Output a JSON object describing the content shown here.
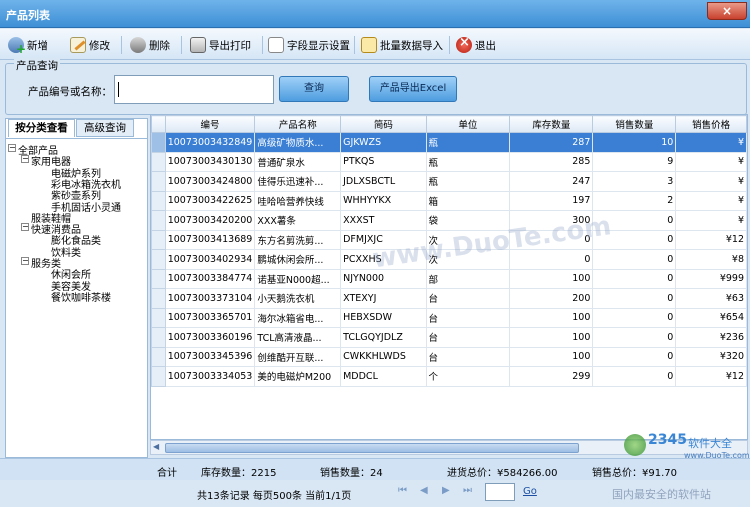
{
  "window": {
    "title": "产品列表",
    "close_glyph": "×"
  },
  "toolbar": {
    "add": "新增",
    "edit": "修改",
    "delete": "删除",
    "export_print": "导出打印",
    "field_settings": "字段显示设置",
    "batch_import": "批量数据导入",
    "exit": "退出"
  },
  "query": {
    "legend": "产品查询",
    "label": "产品编号或名称：",
    "value": "",
    "search_button": "查询",
    "export_excel_button": "产品导出Excel"
  },
  "left_tabs": {
    "active": "按分类查看",
    "inactive": "高级查询"
  },
  "tree": [
    {
      "label": "全部产品",
      "level": 0,
      "box": "−"
    },
    {
      "label": "家用电器",
      "level": 1,
      "box": "−"
    },
    {
      "label": "电磁炉系列",
      "level": 2
    },
    {
      "label": "彩电冰箱洗衣机",
      "level": 2
    },
    {
      "label": "紫砂壶系列",
      "level": 2
    },
    {
      "label": "手机固话小灵通",
      "level": 2
    },
    {
      "label": "服装鞋帽",
      "level": 1
    },
    {
      "label": "快速消费品",
      "level": 1,
      "box": "−"
    },
    {
      "label": "膨化食品类",
      "level": 2
    },
    {
      "label": "饮料类",
      "level": 2
    },
    {
      "label": "服务类",
      "level": 1,
      "box": "−"
    },
    {
      "label": "休闲会所",
      "level": 2
    },
    {
      "label": "美容美发",
      "level": 2
    },
    {
      "label": "餐饮咖啡茶楼",
      "level": 2
    }
  ],
  "table": {
    "columns": [
      "编号",
      "产品名称",
      "简码",
      "单位",
      "库存数量",
      "销售数量",
      "销售价格"
    ],
    "rows": [
      [
        "10073003432849",
        "高级矿物质水...",
        "GJKWZS",
        "瓶",
        "287",
        "10",
        "¥"
      ],
      [
        "10073003430130",
        "普通矿泉水",
        "PTKQS",
        "瓶",
        "285",
        "9",
        "¥"
      ],
      [
        "10073003424800",
        "佳得乐迅速补...",
        "JDLXSBCTL",
        "瓶",
        "247",
        "3",
        "¥"
      ],
      [
        "10073003422625",
        "哇哈哈营养快线",
        "WHHYYKX",
        "箱",
        "197",
        "2",
        "¥"
      ],
      [
        "10073003420200",
        "XXX薯条",
        "XXXST",
        "袋",
        "300",
        "0",
        "¥"
      ],
      [
        "10073003413689",
        "东方名剪洗剪...",
        "DFMJXJC",
        "次",
        "0",
        "0",
        "¥12"
      ],
      [
        "10073003402934",
        "鹏城休闲会所...",
        "PCXXHS",
        "次",
        "0",
        "0",
        "¥8"
      ],
      [
        "10073003384774",
        "诺基亚N000超...",
        "NJYN000",
        "部",
        "100",
        "0",
        "¥999"
      ],
      [
        "10073003373104",
        "小天鹅洗衣机",
        "XTEXYJ",
        "台",
        "200",
        "0",
        "¥63"
      ],
      [
        "10073003365701",
        "海尔冰箱省电...",
        "HEBXSDW",
        "台",
        "100",
        "0",
        "¥654"
      ],
      [
        "10073003360196",
        "TCL高清液晶...",
        "TCLGQYJDLZ",
        "台",
        "100",
        "0",
        "¥236"
      ],
      [
        "10073003345396",
        "创维酷开互联...",
        "CWKKHLWDS",
        "台",
        "100",
        "0",
        "¥320"
      ],
      [
        "10073003334053",
        "美的电磁炉M200",
        "MDDCL",
        "个",
        "299",
        "0",
        "¥12"
      ]
    ]
  },
  "summary": {
    "label": "合计",
    "stock": "库存数量：2215",
    "sales": "销售数量：24",
    "purchase_total": "进货总价：¥584266.00",
    "sales_total": "销售总价：¥91.70"
  },
  "pager": {
    "info": "共13条记录  每页500条  当前1/1页",
    "go": "Go",
    "first": "⏮",
    "prev": "◀",
    "next": "▶",
    "last": "⏭"
  },
  "watermarks": {
    "center": "www.DuoTe.com",
    "logo_digits": "2345",
    "logo_text": "软件大全",
    "logo_url": "www.DuoTe.com",
    "slogan": "国内最安全的软件站"
  },
  "colors": {
    "selected_row": "#3a7fd4",
    "title_bar": "#4a98dc"
  }
}
